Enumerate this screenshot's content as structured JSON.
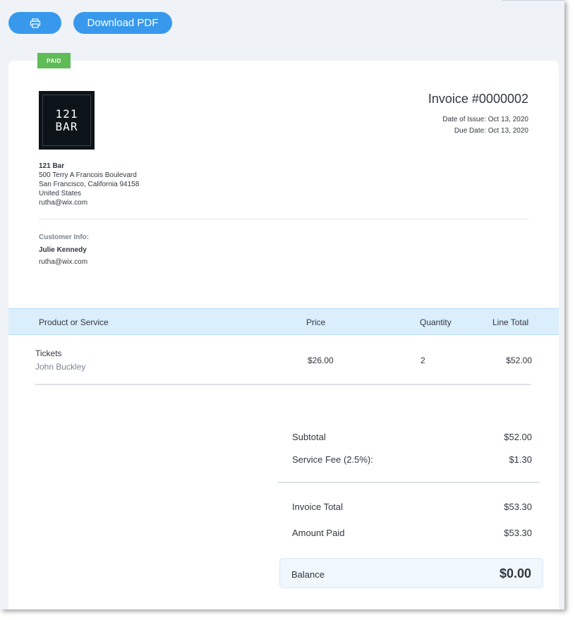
{
  "toolbar": {
    "download_label": "Download PDF"
  },
  "status_badge": "PAID",
  "business": {
    "logo_line1": "121",
    "logo_line2": "BAR",
    "name": "121 Bar",
    "address1": "500 Terry A Francois Boulevard",
    "address2": "San Francisco, California 94158",
    "country": "United States",
    "email": "rutha@wix.com"
  },
  "invoice": {
    "title": "Invoice #0000002",
    "date_of_issue": "Date of Issue: Oct 13, 2020",
    "due_date": "Due Date: Oct 13, 2020"
  },
  "customer": {
    "label": "Customer Info:",
    "name": "Julie Kennedy",
    "email": "rutha@wix.com"
  },
  "table": {
    "headers": {
      "product": "Product or Service",
      "price": "Price",
      "quantity": "Quantity",
      "line_total": "Line Total"
    },
    "rows": [
      {
        "product": "Tickets",
        "detail": "John Buckley",
        "price": "$26.00",
        "quantity": "2",
        "line_total": "$52.00"
      }
    ]
  },
  "totals": {
    "subtotal_label": "Subtotal",
    "subtotal_value": "$52.00",
    "fee_label": "Service Fee (2.5%):",
    "fee_value": "$1.30",
    "invoice_total_label": "Invoice Total",
    "invoice_total_value": "$53.30",
    "amount_paid_label": "Amount Paid",
    "amount_paid_value": "$53.30",
    "balance_label": "Balance",
    "balance_value": "$0.00"
  },
  "colors": {
    "accent": "#3899ec",
    "paid_badge": "#60bc57",
    "table_header_bg": "#dbeefc",
    "page_bg": "#eff3f7"
  },
  "icons": {
    "print": "print-icon"
  }
}
